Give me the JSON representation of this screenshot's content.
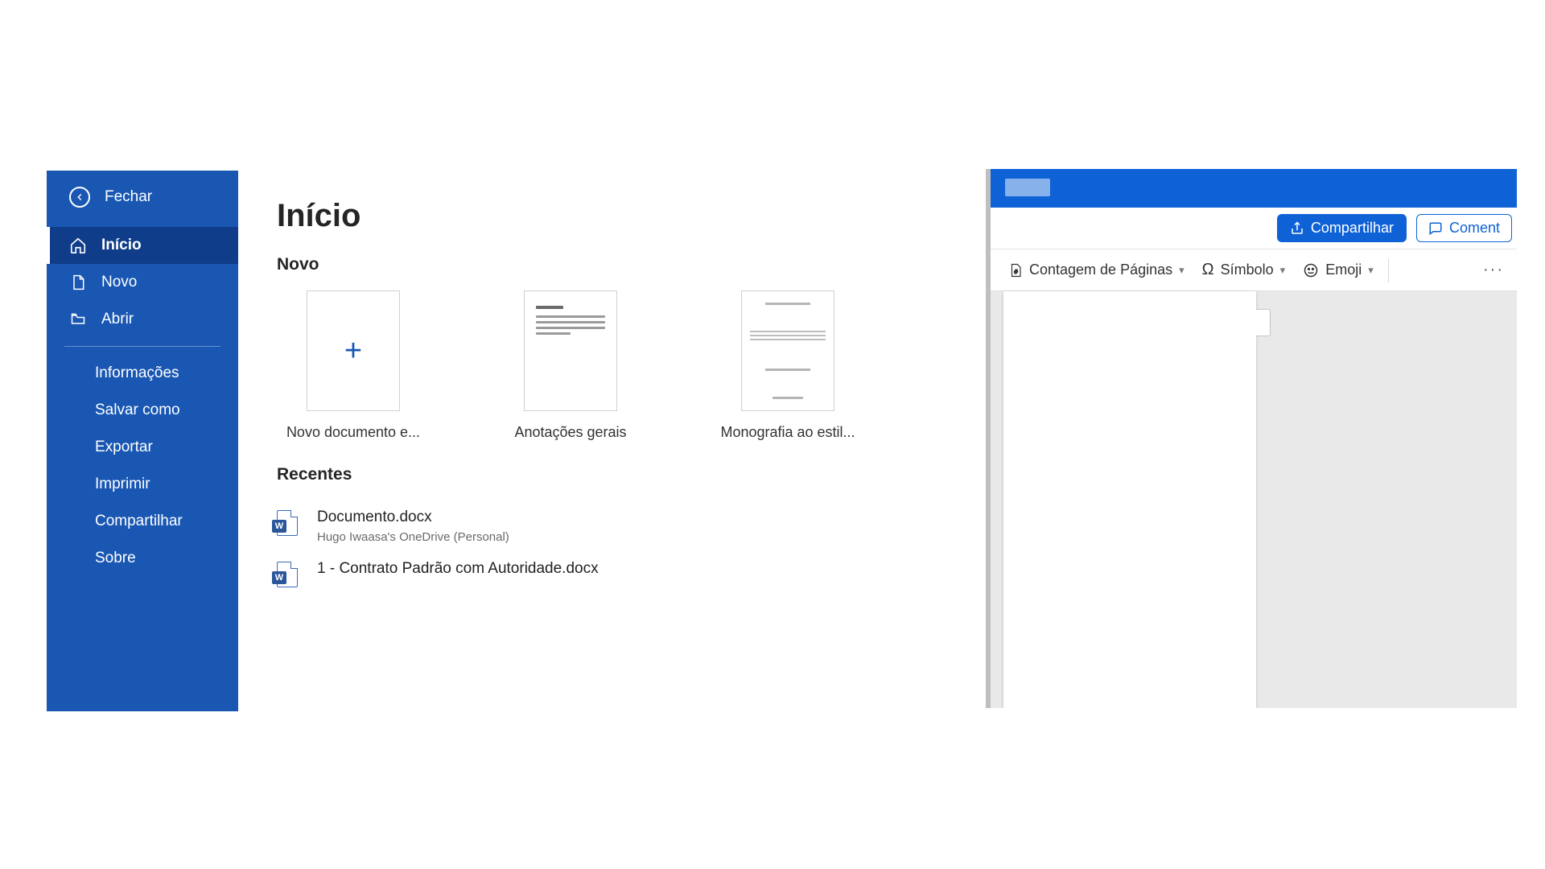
{
  "sidebar": {
    "close_label": "Fechar",
    "items": [
      {
        "label": "Início",
        "icon": "home"
      },
      {
        "label": "Novo",
        "icon": "file"
      },
      {
        "label": "Abrir",
        "icon": "folder"
      }
    ],
    "secondary": [
      {
        "label": "Informações"
      },
      {
        "label": "Salvar como"
      },
      {
        "label": "Exportar"
      },
      {
        "label": "Imprimir"
      },
      {
        "label": "Compartilhar"
      },
      {
        "label": "Sobre"
      }
    ]
  },
  "backstage": {
    "title": "Início",
    "new_section": "Novo",
    "templates": [
      {
        "label": "Novo documento e..."
      },
      {
        "label": "Anotações gerais"
      },
      {
        "label": "Monografia ao estil..."
      }
    ],
    "recent_section": "Recentes",
    "recent": [
      {
        "name": "Documento.docx",
        "location": "Hugo Iwaasa's OneDrive (Personal)"
      },
      {
        "name": "1 - Contrato Padrão com Autoridade.docx",
        "location": ""
      }
    ]
  },
  "editor": {
    "share_button": "Compartilhar",
    "comment_button": "Coment",
    "ribbon": {
      "page_count": "Contagem de Páginas",
      "symbol": "Símbolo",
      "emoji": "Emoji"
    }
  },
  "colors": {
    "brand_blue": "#0f62d6",
    "sidebar_blue": "#1957b3",
    "sidebar_active": "#0f3d8a"
  }
}
